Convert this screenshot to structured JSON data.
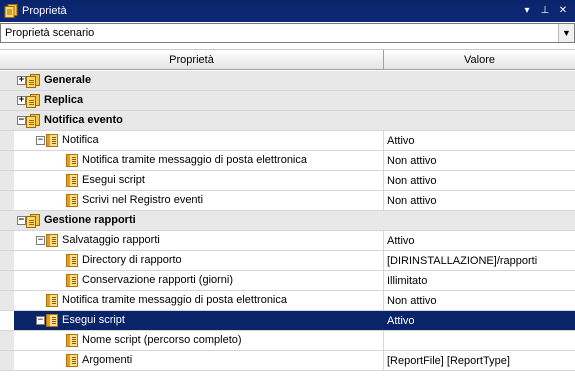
{
  "window": {
    "title": "Proprietà",
    "controls": {
      "menu": "▾",
      "pin": "⊥",
      "close": "✕"
    }
  },
  "scenario_select": {
    "value": "Proprietà scenario"
  },
  "grid": {
    "col_property": "Proprietà",
    "col_value": "Valore",
    "rows": [
      {
        "label": "Generale",
        "value": "",
        "type": "group",
        "expander": "+"
      },
      {
        "label": "Replica",
        "value": "",
        "type": "group",
        "expander": "+"
      },
      {
        "label": "Notifica evento",
        "value": "",
        "type": "group",
        "expander": "−"
      },
      {
        "label": "Notifica",
        "value": "Attivo",
        "type": "prop",
        "expander": "−"
      },
      {
        "label": "Notifica tramite messaggio di posta elettronica",
        "value": "Non attivo",
        "type": "prop"
      },
      {
        "label": "Esegui script",
        "value": "Non attivo",
        "type": "prop"
      },
      {
        "label": "Scrivi nel Registro eventi",
        "value": "Non attivo",
        "type": "prop"
      },
      {
        "label": "Gestione rapporti",
        "value": "",
        "type": "group",
        "expander": "−"
      },
      {
        "label": "Salvataggio rapporti",
        "value": "Attivo",
        "type": "prop",
        "expander": "−"
      },
      {
        "label": "Directory di rapporto",
        "value": "[DIRINSTALLAZIONE]/rapporti",
        "type": "prop"
      },
      {
        "label": "Conservazione rapporti (giorni)",
        "value": "Illimitato",
        "type": "prop"
      },
      {
        "label": "Notifica tramite messaggio di posta elettronica",
        "value": "Non attivo",
        "type": "prop"
      },
      {
        "label": "Esegui script",
        "value": "Attivo",
        "type": "prop",
        "expander": "−",
        "selected": true
      },
      {
        "label": "Nome script (percorso completo)",
        "value": "",
        "type": "prop"
      },
      {
        "label": "Argomenti",
        "value": "[ReportFile] [ReportType]",
        "type": "prop"
      }
    ]
  },
  "colors": {
    "selection": "#0a246a",
    "group_bg": "#e8e8e8"
  }
}
